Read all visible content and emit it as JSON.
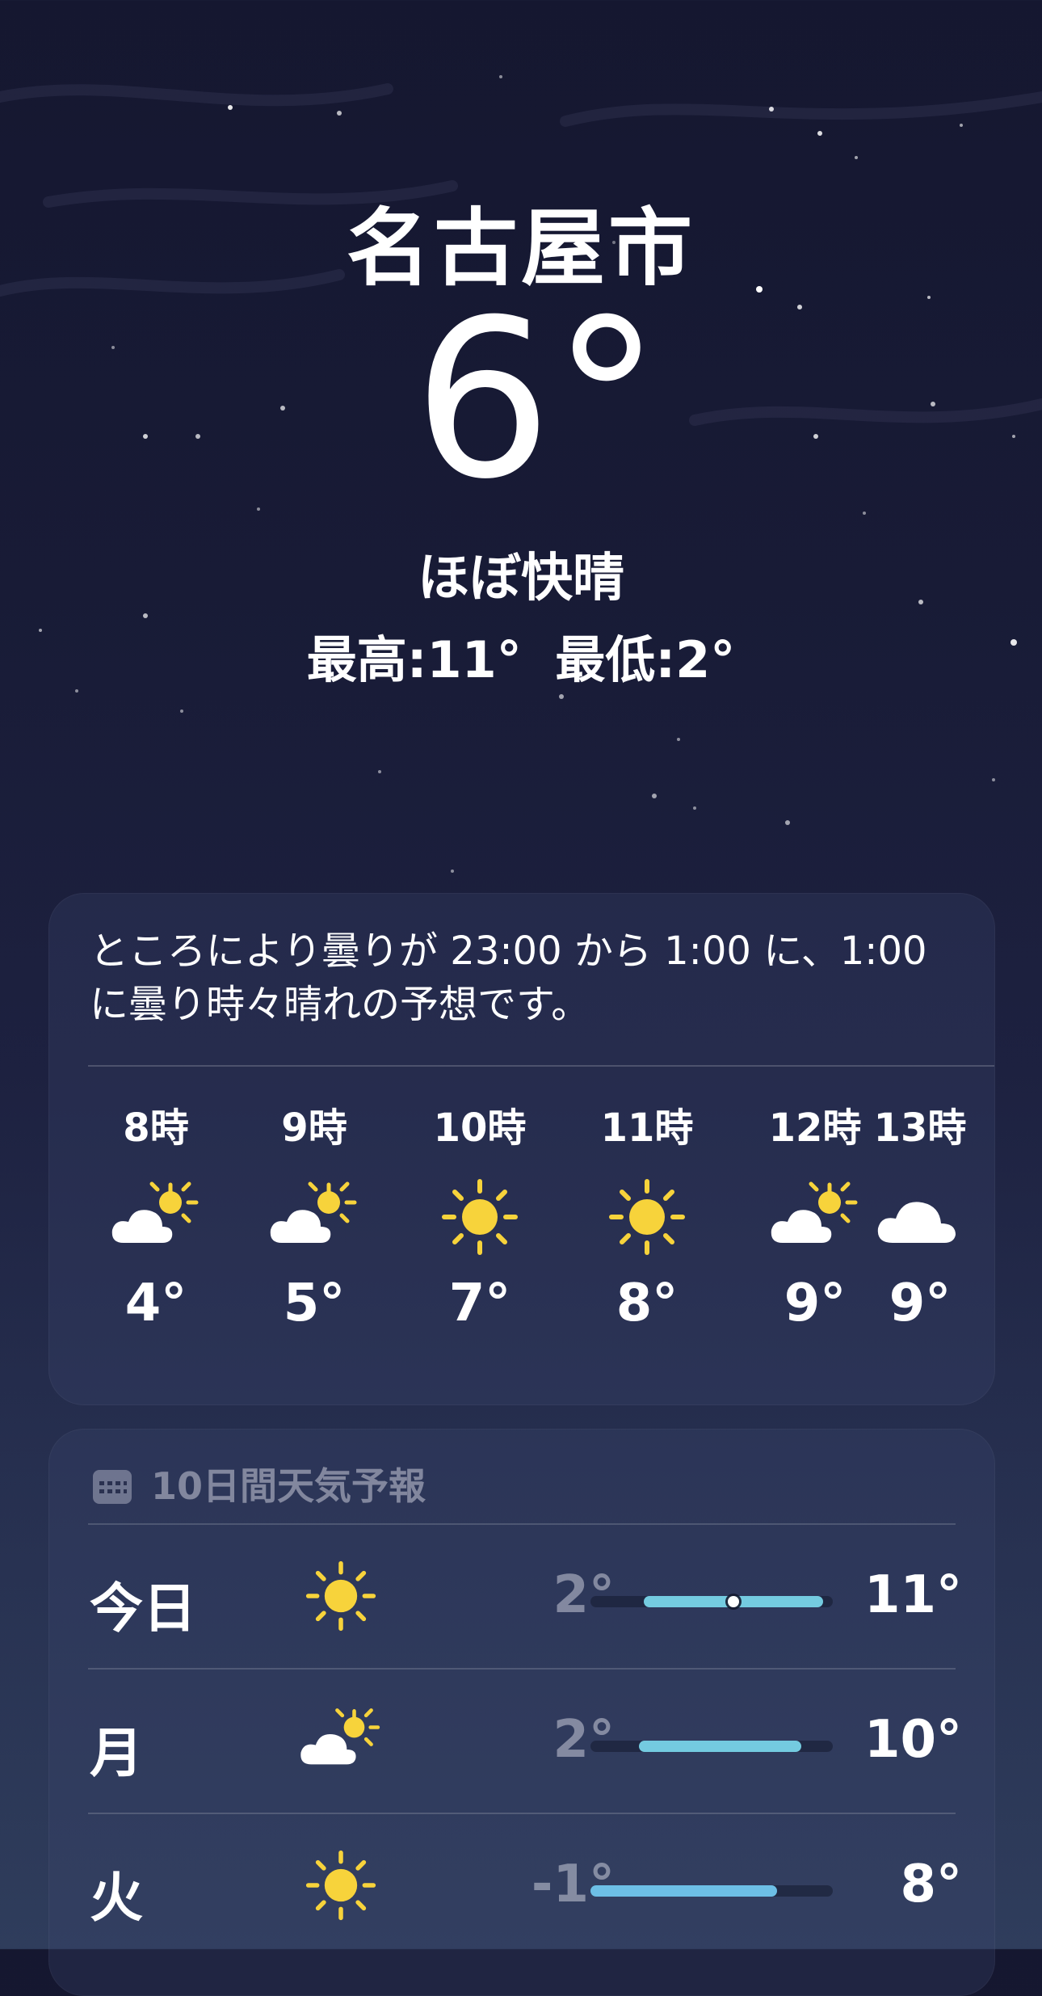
{
  "location": {
    "city": "名古屋市",
    "temperature": "6°",
    "condition": "ほぼ快晴",
    "high": "最高:11°",
    "low": "最低:2°"
  },
  "hourly": {
    "summary": "ところにより曇りが 23:00 から 1:00 に、1:00 に曇り時々晴れの予想です。",
    "hours": [
      {
        "time": "8時",
        "icon": "partly-cloudy-icon",
        "temp": "4°"
      },
      {
        "time": "9時",
        "icon": "partly-cloudy-icon",
        "temp": "5°"
      },
      {
        "time": "10時",
        "icon": "sun-icon",
        "temp": "7°"
      },
      {
        "time": "11時",
        "icon": "sun-icon",
        "temp": "8°"
      },
      {
        "time": "12時",
        "icon": "partly-cloudy-icon",
        "temp": "9°"
      },
      {
        "time": "13時",
        "icon": "cloud-icon",
        "temp": "9°"
      }
    ]
  },
  "daily": {
    "title": "10日間天気予報",
    "days": [
      {
        "day": "今日",
        "icon": "sun-icon",
        "low": "2°",
        "high": "11°",
        "range_start": 0.22,
        "range_end": 0.96,
        "current": 0.59,
        "color": "#74cbe0"
      },
      {
        "day": "月",
        "icon": "partly-cloudy-icon",
        "low": "2°",
        "high": "10°",
        "range_start": 0.2,
        "range_end": 0.87,
        "color": "#74cbe0"
      },
      {
        "day": "火",
        "icon": "sun-icon",
        "low": "-1°",
        "high": "8°",
        "range_start": 0.0,
        "range_end": 0.77,
        "color": "#6dbfe6"
      }
    ]
  },
  "colors": {
    "sun": "#f7d33b",
    "cloud": "#ffffff",
    "bar_track": "#1b2036"
  }
}
